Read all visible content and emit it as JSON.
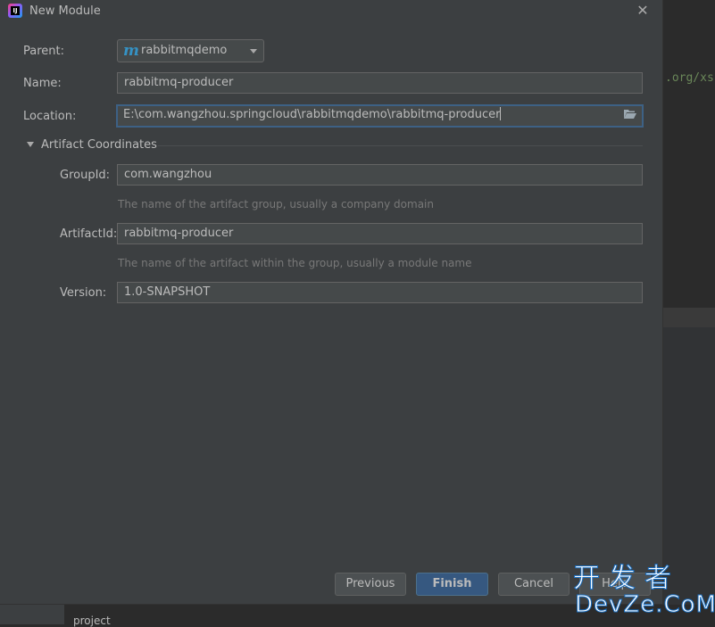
{
  "window": {
    "title": "New Module",
    "close_symbol": "✕"
  },
  "form": {
    "parent_label": "Parent:",
    "parent_value": "rabbitmqdemo",
    "parent_icon_glyph": "m",
    "name_label": "Name:",
    "name_value": "rabbitmq-producer",
    "location_label": "Location:",
    "location_value": "E:\\com.wangzhou.springcloud\\rabbitmqdemo\\rabbitmq-producer"
  },
  "artifact": {
    "section_title": "Artifact Coordinates",
    "group_label": "GroupId:",
    "group_value": "com.wangzhou",
    "group_hint": "The name of the artifact group, usually a company domain",
    "artifact_label": "ArtifactId:",
    "artifact_value": "rabbitmq-producer",
    "artifact_hint": "The name of the artifact within the group, usually a module name",
    "version_label": "Version:",
    "version_value": "1.0-SNAPSHOT"
  },
  "buttons": {
    "previous": "Previous",
    "finish": "Finish",
    "cancel": "Cancel",
    "help": "Help"
  },
  "background": {
    "code_snippet": ".org/xs",
    "project_label": "project"
  },
  "watermark": {
    "line1": "开发者",
    "line2": "DevZe.CoM"
  },
  "colors": {
    "dialog_bg": "#3c3f41",
    "field_bg": "#45494a",
    "focus_border": "#3d6185",
    "primary_button": "#365880",
    "maven_icon": "#3592c4",
    "code_string": "#6a8759"
  },
  "icons": [
    "intellij-app-icon",
    "close-icon",
    "maven-module-icon",
    "chevron-down-icon",
    "folder-open-icon",
    "triangle-expanded-icon"
  ]
}
